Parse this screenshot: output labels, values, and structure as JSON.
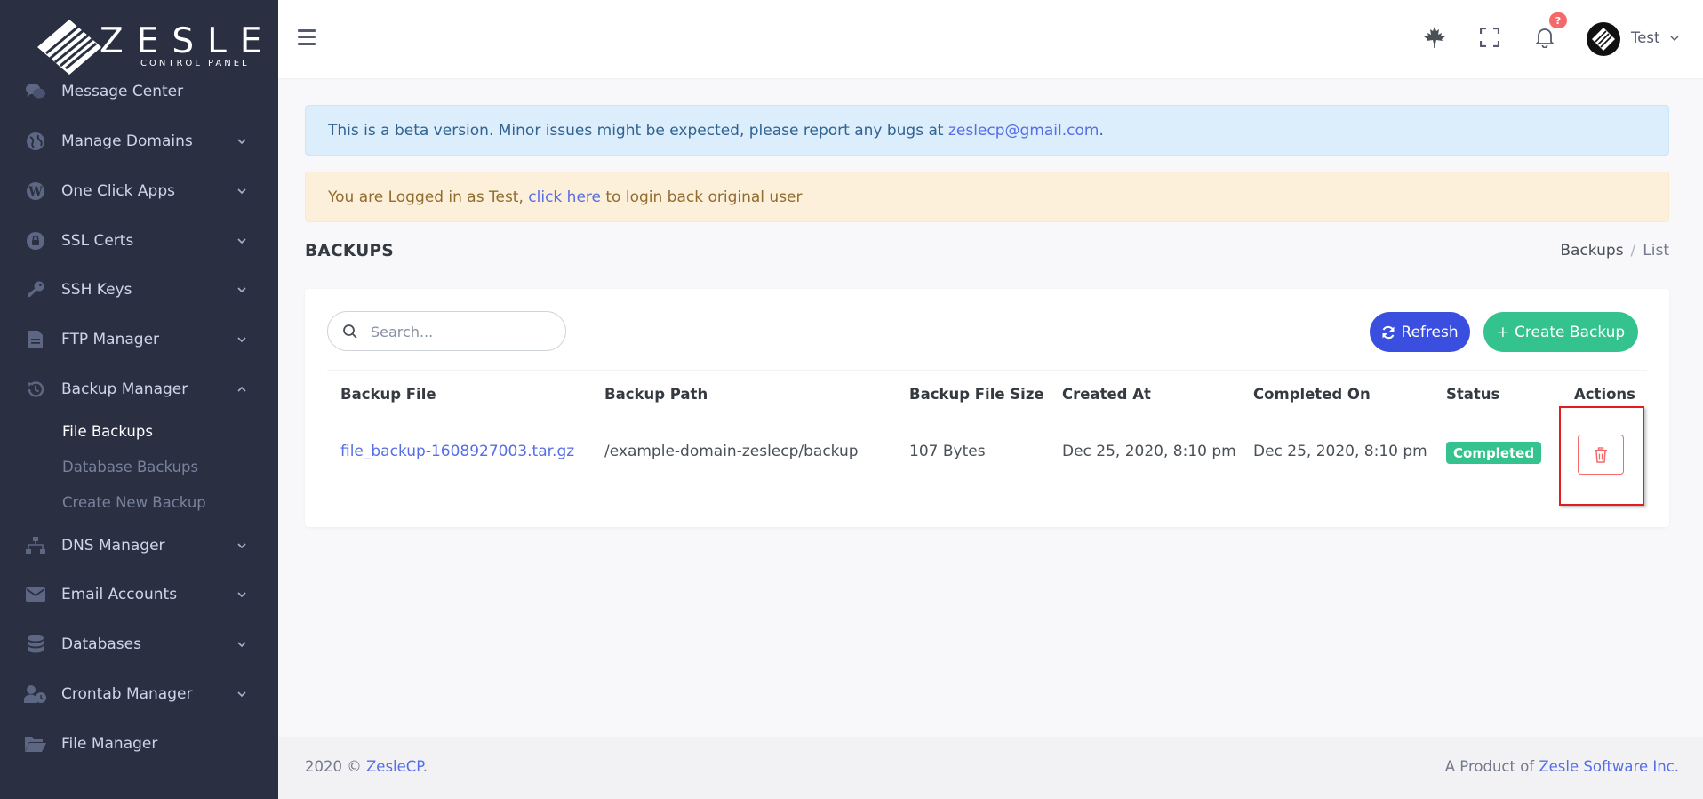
{
  "brand": {
    "name": "ZESLE",
    "tagline": "CONTROL PANEL"
  },
  "sidebar": {
    "items": [
      {
        "label": "Message Center",
        "icon": "chat-icon"
      },
      {
        "label": "Manage Domains",
        "icon": "globe-icon"
      },
      {
        "label": "One Click Apps",
        "icon": "wordpress-icon"
      },
      {
        "label": "SSL Certs",
        "icon": "lock-icon"
      },
      {
        "label": "SSH Keys",
        "icon": "key-icon"
      },
      {
        "label": "FTP Manager",
        "icon": "file-icon"
      },
      {
        "label": "Backup Manager",
        "icon": "history-icon"
      },
      {
        "label": "DNS Manager",
        "icon": "network-icon"
      },
      {
        "label": "Email Accounts",
        "icon": "envelope-icon"
      },
      {
        "label": "Databases",
        "icon": "database-icon"
      },
      {
        "label": "Crontab Manager",
        "icon": "user-clock-icon"
      },
      {
        "label": "File Manager",
        "icon": "folder-open-icon"
      }
    ],
    "backup_subitems": [
      {
        "label": "File Backups",
        "active": true
      },
      {
        "label": "Database Backups",
        "active": false
      },
      {
        "label": "Create New Backup",
        "active": false
      }
    ]
  },
  "topbar": {
    "notification_count": "?",
    "username": "Test",
    "icons": [
      "menu-icon",
      "maple-leaf-icon",
      "fullscreen-icon",
      "bell-icon"
    ]
  },
  "alerts": {
    "beta_text": "This is a beta version. Minor issues might be expected, please report any bugs at ",
    "beta_email": "zeslecp@gmail.com",
    "beta_end": ".",
    "login_text": "You are Logged in as Test, ",
    "login_link": "click here",
    "login_end": " to login back original user"
  },
  "page": {
    "title": "BACKUPS",
    "breadcrumb": [
      "Backups",
      "List"
    ]
  },
  "toolbar": {
    "search_placeholder": "Search...",
    "refresh_label": "Refresh",
    "create_label": "Create Backup"
  },
  "table": {
    "columns": [
      "Backup File",
      "Backup Path",
      "Backup File Size",
      "Created At",
      "Completed On",
      "Status",
      "Actions"
    ],
    "rows": [
      {
        "file": "file_backup-1608927003.tar.gz",
        "path": "/example-domain-zeslecp/backup",
        "size": "107 Bytes",
        "created": "Dec 25, 2020, 8:10 pm",
        "completed": "Dec 25, 2020, 8:10 pm",
        "status": "Completed"
      }
    ]
  },
  "footer": {
    "copy": "2020 © ",
    "copy_link": "ZesleCP",
    "copy_end": ".",
    "product": "A Product of ",
    "product_link": "Zesle Software Inc."
  },
  "colors": {
    "sidebar_bg": "#2a3042",
    "primary": "#556ee6",
    "success": "#34c38f",
    "danger": "#f46a6a"
  }
}
